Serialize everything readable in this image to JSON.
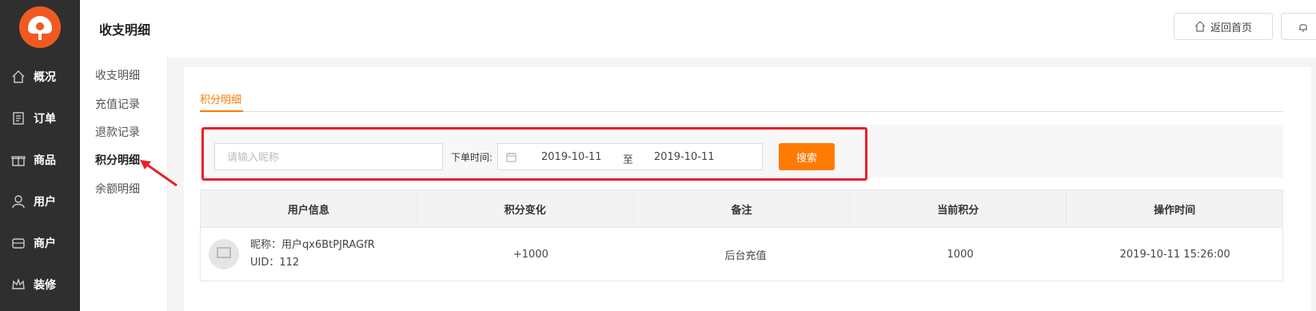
{
  "header": {
    "title": "收支明细",
    "home_label": "返回首页"
  },
  "sidebar": {
    "items": [
      {
        "label": "概况",
        "icon": "home-icon"
      },
      {
        "label": "订单",
        "icon": "order-icon"
      },
      {
        "label": "商品",
        "icon": "gift-icon"
      },
      {
        "label": "用户",
        "icon": "user-icon"
      },
      {
        "label": "商户",
        "icon": "shop-icon"
      },
      {
        "label": "装修",
        "icon": "crown-icon"
      }
    ]
  },
  "subnav": {
    "items": [
      "收支明细",
      "充值记录",
      "退款记录",
      "积分明细",
      "余额明细"
    ],
    "active": "积分明细"
  },
  "main": {
    "tab": "积分明细",
    "filter": {
      "nickname_placeholder": "请输入昵称",
      "date_label": "下单时间:",
      "date_start": "2019-10-11",
      "date_sep": "至",
      "date_end": "2019-10-11",
      "search_label": "搜索"
    },
    "table": {
      "headers": [
        "用户信息",
        "积分变化",
        "备注",
        "当前积分",
        "操作时间"
      ],
      "rows": [
        {
          "nickname": "昵称：用户qx6BtPJRAGfR",
          "uid": "UID：112",
          "change": "+1000",
          "remark": "后台充值",
          "current": "1000",
          "time": "2019-10-11 15:26:00"
        }
      ]
    }
  },
  "colors": {
    "accent": "#ff7a00",
    "highlight": "#e8202a",
    "sidebar": "#2f2f2f"
  }
}
